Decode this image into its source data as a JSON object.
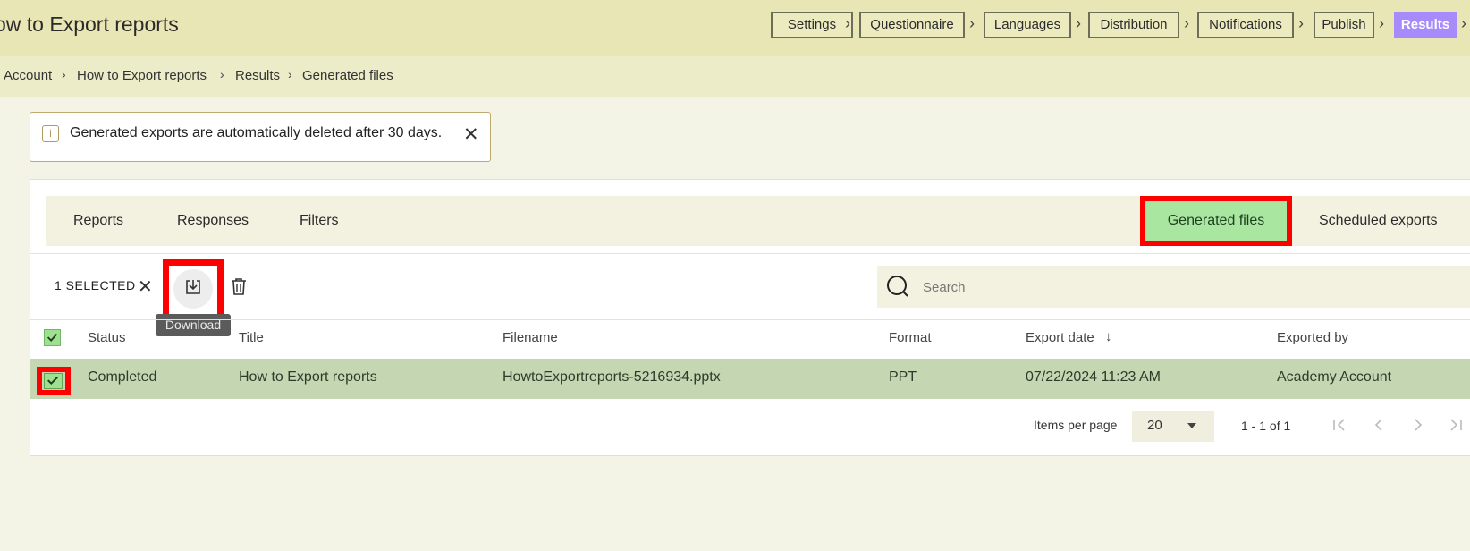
{
  "header": {
    "title": "ow to Export reports",
    "steps": [
      "Settings",
      "Questionnaire",
      "Languages",
      "Distribution",
      "Notifications",
      "Publish",
      "Results"
    ],
    "active_step": "Results"
  },
  "breadcrumb": [
    "Account",
    "How to Export reports",
    "Results",
    "Generated files"
  ],
  "notice": {
    "text": "Generated exports are automatically deleted after 30 days."
  },
  "tabs": {
    "left": [
      "Reports",
      "Responses",
      "Filters"
    ],
    "generated": "Generated files",
    "scheduled": "Scheduled exports"
  },
  "toolbar": {
    "selected_label": "1 SELECTED",
    "tooltip": "Download",
    "search_placeholder": "Search"
  },
  "table": {
    "columns": [
      "Status",
      "Title",
      "Filename",
      "Format",
      "Export date",
      "Exported by"
    ],
    "rows": [
      {
        "status": "Completed",
        "title": "How to Export reports",
        "filename": "HowtoExportreports-5216934.pptx",
        "format": "PPT",
        "export_date": "07/22/2024 11:23 AM",
        "exported_by": "Academy Account"
      }
    ]
  },
  "pagination": {
    "items_per_page_label": "Items per page",
    "page_size": "20",
    "range": "1 - 1 of 1"
  },
  "colors": {
    "accent": "#a78bfa",
    "generated_tab": "#a9e7a0",
    "highlight": "#ff0000",
    "row_selected": "#c4d7b2"
  }
}
